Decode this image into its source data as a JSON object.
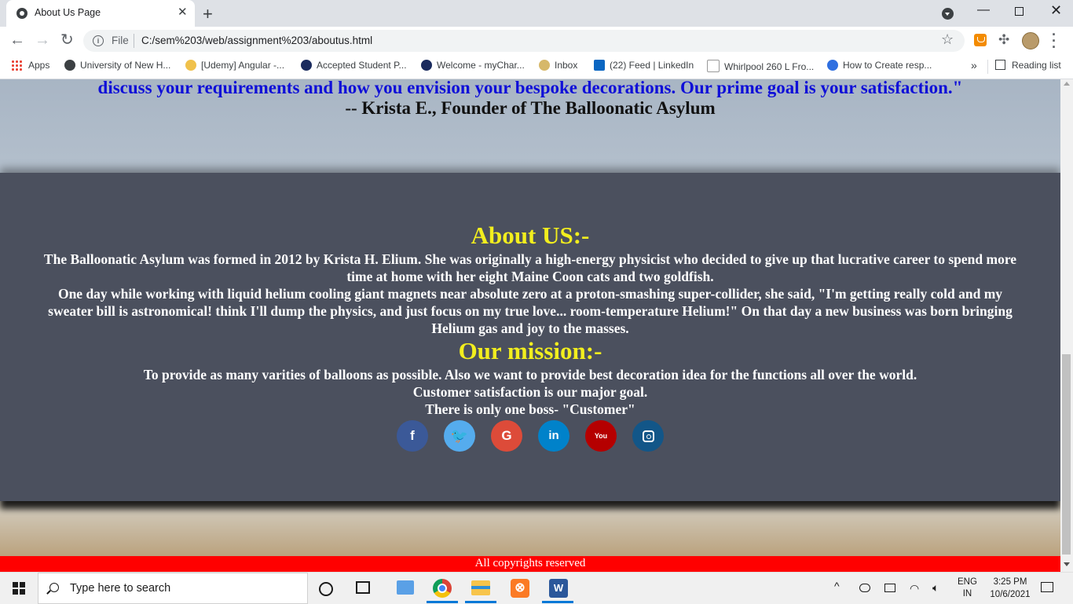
{
  "browser": {
    "tab_title": "About Us Page",
    "tab_close": "✕",
    "new_tab": "+",
    "file_label": "File",
    "url": "C:/sem%203/web/assignment%203/aboutus.html",
    "window_min": "—",
    "window_close": "✕",
    "bookmarks": [
      {
        "label": "Apps"
      },
      {
        "label": "University of New H..."
      },
      {
        "label": "[Udemy] Angular -..."
      },
      {
        "label": "Accepted Student P..."
      },
      {
        "label": "Welcome - myChar..."
      },
      {
        "label": "Inbox"
      },
      {
        "label": "(22) Feed | LinkedIn"
      },
      {
        "label": "Whirlpool 260 L Fro..."
      },
      {
        "label": "How to Create resp..."
      }
    ],
    "bookmarks_more": "»",
    "reading_list": "Reading list"
  },
  "page": {
    "quote_line": "discuss your requirements and how you envision your bespoke decorations. Our prime goal is your satisfaction.\"",
    "quote_author": "-- Krista E., Founder of The Balloonatic Asylum",
    "about_heading": "About US:-",
    "about_p1": "The Balloonatic Asylum was formed in 2012 by Krista H. Elium. She was originally a high-energy physicist who decided to give up that lucrative career to spend more time at home with her eight Maine Coon cats and two goldfish.",
    "about_p2": "One day while working with liquid helium cooling giant magnets near absolute zero at a proton-smashing super-collider, she said, \"I'm getting really cold and my sweater bill is astronomical! think I'll dump the physics, and just focus on my true love... room-temperature Helium!\" On that day a new business was born bringing Helium gas and joy to the masses.",
    "mission_heading": "Our mission:-",
    "mission_lines": [
      "To provide as many varities of balloons as possible. Also we want to provide best decoration idea for the functions all over the world.",
      "Customer satisfaction is our major goal.",
      "There is only one boss- \"Customer\""
    ],
    "social": [
      {
        "name": "facebook",
        "glyph": "f",
        "color": "#3b5998"
      },
      {
        "name": "twitter",
        "glyph": "🐦",
        "color": "#55acee"
      },
      {
        "name": "google",
        "glyph": "G",
        "color": "#dd4b39"
      },
      {
        "name": "linkedin",
        "glyph": "in",
        "color": "#0082ca"
      },
      {
        "name": "youtube",
        "glyph": "You",
        "color": "#b50000"
      },
      {
        "name": "instagram",
        "glyph": "",
        "color": "#125688"
      }
    ],
    "footer": "All copyrights reserved",
    "colors": {
      "quote": "#0f0fd8",
      "heading": "#f2ee1e",
      "panel": "#4b505e",
      "footer": "#ff0000"
    }
  },
  "taskbar": {
    "search_placeholder": "Type here to search",
    "lang_top": "ENG",
    "lang_bottom": "IN",
    "time": "3:25 PM",
    "date": "10/6/2021",
    "tray_caret": "^"
  }
}
